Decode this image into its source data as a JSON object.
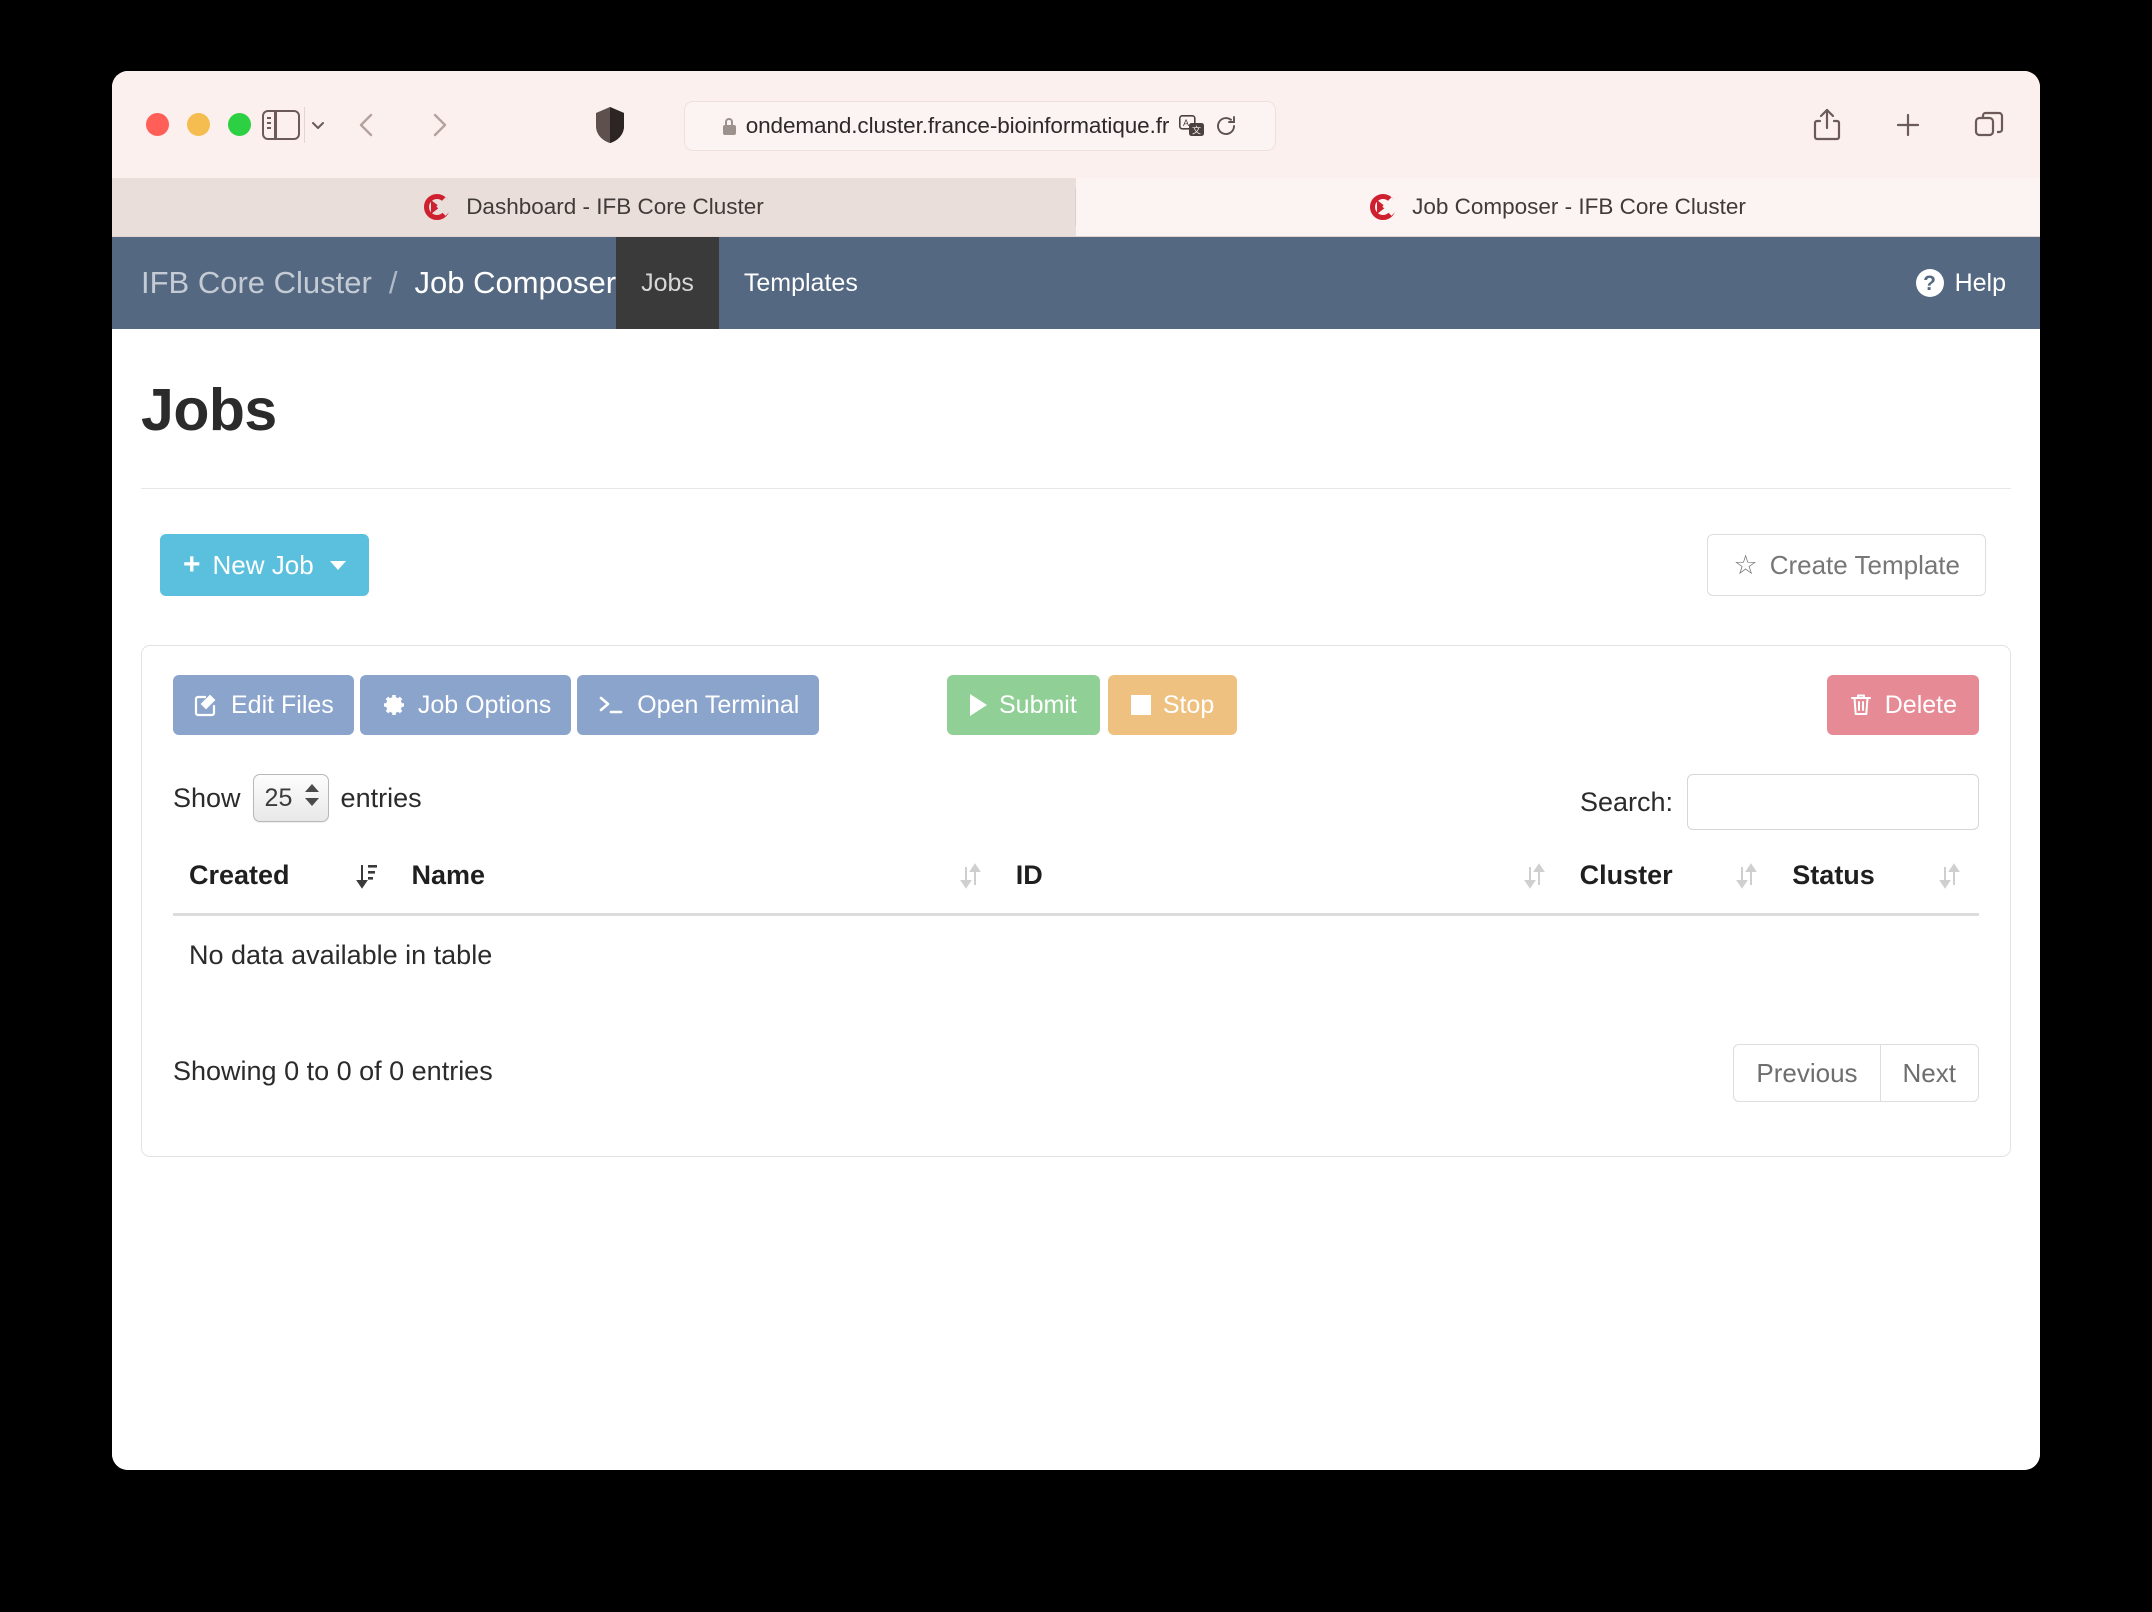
{
  "browser": {
    "url": "ondemand.cluster.france-bioinformatique.fr",
    "lock_icon": "lock-icon",
    "translate_icon": "translate-icon",
    "reload_icon": "reload-icon",
    "share_icon": "share-icon",
    "new_tab_icon": "plus-icon",
    "tab_overview_icon": "tab-overview-icon",
    "sidebar_icon": "sidebar-toggle-icon",
    "shield_icon": "privacy-shield-icon",
    "back_icon": "chevron-left-icon",
    "forward_icon": "chevron-right-icon",
    "tabs": [
      {
        "title": "Dashboard - IFB Core Cluster",
        "active": false
      },
      {
        "title": "Job Composer - IFB Core Cluster",
        "active": true
      }
    ]
  },
  "navbar": {
    "brand_cluster": "IFB Core Cluster",
    "brand_separator": "/",
    "brand_app": "Job Composer",
    "items": [
      {
        "label": "Jobs",
        "selected": true
      },
      {
        "label": "Templates",
        "selected": false
      }
    ],
    "help_label": "Help",
    "help_icon": "question-mark-circle-icon",
    "bg_color": "#546881",
    "selected_bg_color": "#3a3a3a"
  },
  "page": {
    "title": "Jobs",
    "new_job_label": "New Job",
    "new_job_icon": "plus-icon",
    "new_job_caret_icon": "caret-down-icon",
    "new_job_color": "#5bc0de",
    "create_template_label": "Create Template",
    "create_template_icon": "star-icon"
  },
  "toolbar": {
    "edit_files_label": "Edit Files",
    "edit_files_icon": "edit-pencil-icon",
    "job_options_label": "Job Options",
    "job_options_icon": "gear-icon",
    "open_terminal_label": "Open Terminal",
    "open_terminal_icon": "terminal-prompt-icon",
    "submit_label": "Submit",
    "submit_icon": "play-icon",
    "submit_color": "#90cf96",
    "stop_label": "Stop",
    "stop_icon": "stop-square-icon",
    "stop_color": "#efc180",
    "delete_label": "Delete",
    "delete_icon": "trash-icon",
    "delete_color": "#e68b95",
    "blue_button_color": "#8ba4cb"
  },
  "datatable": {
    "show_label": "Show",
    "entries_label": "entries",
    "page_length": "25",
    "search_label": "Search:",
    "search_value": "",
    "search_placeholder": "",
    "columns": [
      {
        "label": "Created",
        "sort_icon": "sort-desc-icon"
      },
      {
        "label": "Name",
        "sort_icon": "sort-both-icon"
      },
      {
        "label": "ID",
        "sort_icon": "sort-both-icon"
      },
      {
        "label": "Cluster",
        "sort_icon": "sort-both-icon"
      },
      {
        "label": "Status",
        "sort_icon": "sort-both-icon"
      }
    ],
    "empty_message": "No data available in table",
    "info_text": "Showing 0 to 0 of 0 entries",
    "previous_label": "Previous",
    "next_label": "Next"
  }
}
